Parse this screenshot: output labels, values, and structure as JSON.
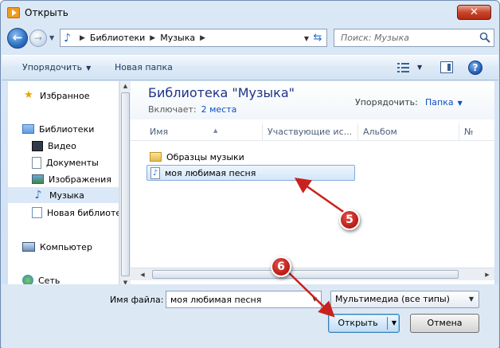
{
  "window": {
    "title": "Открыть",
    "close_glyph": "✕"
  },
  "address": {
    "breadcrumb": [
      "Библиотеки",
      "Музыка"
    ],
    "search_placeholder": "Поиск: Музыка"
  },
  "toolbar": {
    "organize_label": "Упорядочить",
    "new_folder_label": "Новая папка",
    "help_glyph": "?"
  },
  "nav": {
    "favorites": "Избранное",
    "libraries": "Библиотеки",
    "video": "Видео",
    "documents": "Документы",
    "images": "Изображения",
    "music": "Музыка",
    "new_library": "Новая библиотека",
    "computer": "Компьютер",
    "network": "Сеть"
  },
  "library": {
    "title": "Библиотека \"Музыка\"",
    "includes_label": "Включает:",
    "includes_link": "2 места",
    "arrange_label": "Упорядочить:",
    "arrange_value": "Папка"
  },
  "columns": [
    "Имя",
    "Участвующие ис...",
    "Альбом",
    "№"
  ],
  "files": [
    {
      "name": "Образцы музыки",
      "type": "folder"
    },
    {
      "name": "моя любимая песня",
      "type": "song"
    }
  ],
  "bottom": {
    "filename_label": "Имя файла:",
    "filename_value": "моя любимая песня",
    "filetype_value": "Мультимедиа (все типы)",
    "open_label": "Открыть",
    "cancel_label": "Отмена"
  },
  "callouts": {
    "first": "5",
    "second": "6"
  },
  "colors": {
    "callout": "#c9211b",
    "selection": "#d3e6fa",
    "title_blue": "#1e3287"
  }
}
